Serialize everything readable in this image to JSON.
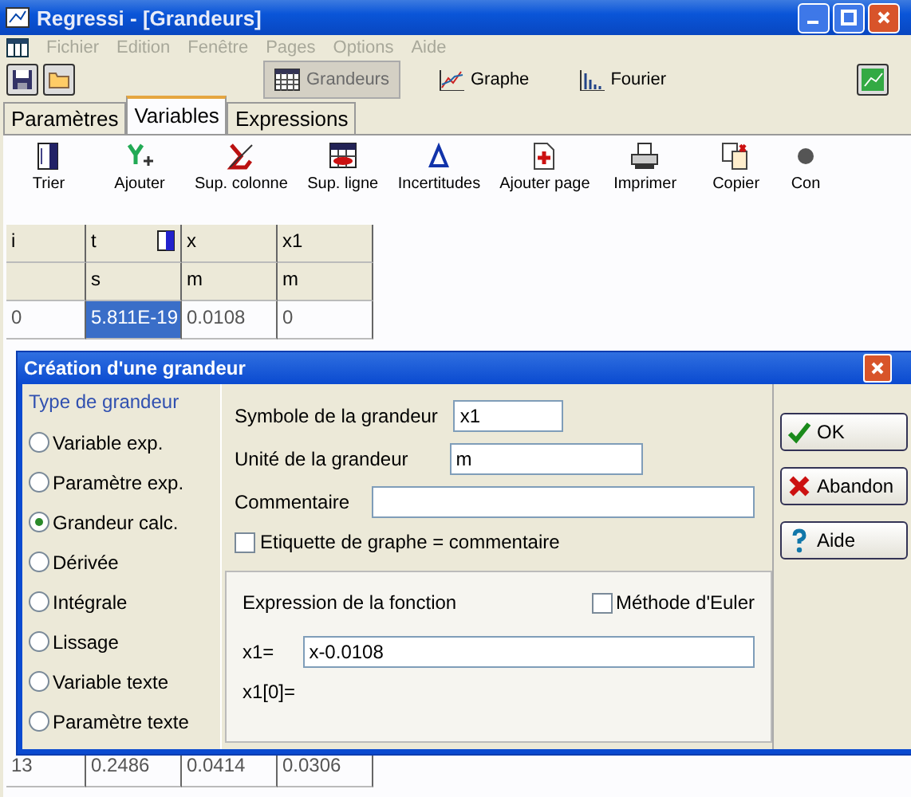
{
  "window": {
    "title": "Regressi  - [Grandeurs]"
  },
  "menu": [
    {
      "label": "Fichier",
      "disabled": true
    },
    {
      "label": "Edition",
      "disabled": true
    },
    {
      "label": "Fenêtre",
      "disabled": true
    },
    {
      "label": "Pages",
      "disabled": true
    },
    {
      "label": "Options",
      "disabled": true
    },
    {
      "label": "Aide",
      "disabled": true
    }
  ],
  "view_buttons": [
    {
      "label": "Grandeurs",
      "selected": true,
      "kind": "table"
    },
    {
      "label": "Graphe",
      "selected": false,
      "kind": "graph"
    },
    {
      "label": "Fourier",
      "selected": false,
      "kind": "fourier"
    }
  ],
  "tabs": [
    {
      "label": "Paramètres",
      "selected": false
    },
    {
      "label": "Variables",
      "selected": true
    },
    {
      "label": "Expressions",
      "selected": false
    }
  ],
  "toolbar": [
    {
      "label": "Trier",
      "kind": "sort"
    },
    {
      "label": "Ajouter",
      "kind": "add"
    },
    {
      "label": "Sup. colonne",
      "kind": "delcol"
    },
    {
      "label": "Sup. ligne",
      "kind": "delrow"
    },
    {
      "label": "Incertitudes",
      "kind": "delta"
    },
    {
      "label": "Ajouter page",
      "kind": "page"
    },
    {
      "label": "Imprimer",
      "kind": "print"
    },
    {
      "label": "Copier",
      "kind": "copy"
    },
    {
      "label": "Con",
      "kind": "other"
    }
  ],
  "table": {
    "columns": [
      "i",
      "t",
      "x",
      "x1"
    ],
    "units": [
      "s",
      "m",
      "m"
    ],
    "rows": [
      {
        "cells": [
          {
            "text": "0",
            "selected": false
          },
          {
            "text": "5.811E-19",
            "selected": true
          },
          {
            "text": "0.0108",
            "selected": false
          },
          {
            "text": "0",
            "selected": false
          }
        ]
      }
    ],
    "rows_below": [
      {
        "cells": [
          {
            "text": "13",
            "selected": false
          },
          {
            "text": "0.2486",
            "selected": false
          },
          {
            "text": "0.0414",
            "selected": false
          },
          {
            "text": "0.0306",
            "selected": false
          }
        ]
      }
    ]
  },
  "dialog": {
    "title": "Création d'une grandeur",
    "type_group": {
      "title": "Type de grandeur",
      "options": [
        {
          "label": "Variable exp.",
          "selected": false
        },
        {
          "label": "Paramètre exp.",
          "selected": false
        },
        {
          "label": "Grandeur calc.",
          "selected": true
        },
        {
          "label": "Dérivée",
          "selected": false
        },
        {
          "label": "Intégrale",
          "selected": false
        },
        {
          "label": "Lissage",
          "selected": false
        },
        {
          "label": "Variable texte",
          "selected": false
        },
        {
          "label": "Paramètre texte",
          "selected": false
        }
      ]
    },
    "symbol": {
      "label": "Symbole de la grandeur",
      "value": "x1"
    },
    "unit": {
      "label": "Unité de la grandeur",
      "value": "m"
    },
    "comment": {
      "label": "Commentaire"
    },
    "graph_label": {
      "label": "Etiquette de graphe = commentaire",
      "checked": false
    },
    "expression": {
      "title": "Expression de la fonction",
      "euler": {
        "label": "Méthode d'Euler",
        "checked": false
      },
      "lhs": "x1=",
      "value": "x-0.0108",
      "initial": "x1[0]="
    },
    "buttons": [
      {
        "label": "OK",
        "kind": "ok"
      },
      {
        "label": "Abandon",
        "kind": "cancel"
      },
      {
        "label": "Aide",
        "kind": "help"
      }
    ]
  }
}
